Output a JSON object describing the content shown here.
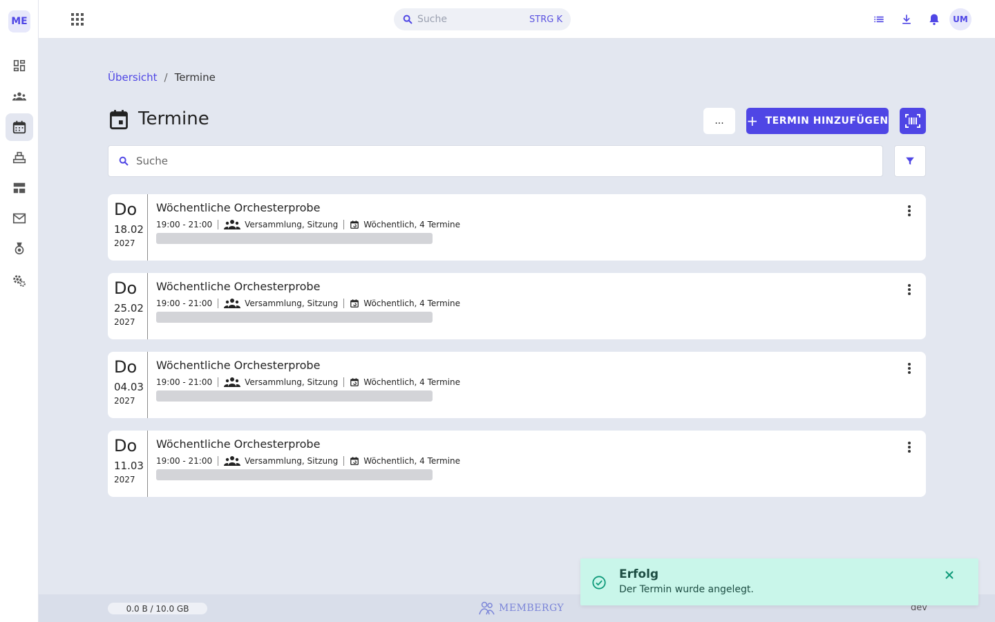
{
  "app": {
    "logo_text": "ME",
    "brand": "MEMBERGY",
    "env": "dev",
    "storage": "0.0 B / 10.0 GB"
  },
  "sidebar": {
    "items": [
      {
        "name": "dashboard",
        "icon": "dashboard-icon"
      },
      {
        "name": "members",
        "icon": "people-icon"
      },
      {
        "name": "events",
        "icon": "calendar-icon",
        "active": true
      },
      {
        "name": "inventory",
        "icon": "inventory-icon"
      },
      {
        "name": "layout",
        "icon": "table-icon"
      },
      {
        "name": "mail",
        "icon": "mail-icon"
      },
      {
        "name": "awards",
        "icon": "medal-icon"
      },
      {
        "name": "settings",
        "icon": "settings-icon"
      }
    ]
  },
  "topbar": {
    "search_placeholder": "Suche",
    "search_shortcut": "STRG K",
    "avatar_initials": "UM",
    "icons": [
      "list-icon",
      "download-icon",
      "bell-icon"
    ]
  },
  "breadcrumb": {
    "home": "Übersicht",
    "separator": "/",
    "current": "Termine"
  },
  "page": {
    "title": "Termine",
    "more_label": "...",
    "add_label": "TERMIN HINZUFÜGEN",
    "search_placeholder": "Suche"
  },
  "events": [
    {
      "dow": "Do",
      "date": "18.02",
      "year": "2027",
      "title": "Wöchentliche Orchesterprobe",
      "time": "19:00 - 21:00",
      "type": "Versammlung, Sitzung",
      "recurrence": "Wöchentlich, 4 Termine"
    },
    {
      "dow": "Do",
      "date": "25.02",
      "year": "2027",
      "title": "Wöchentliche Orchesterprobe",
      "time": "19:00 - 21:00",
      "type": "Versammlung, Sitzung",
      "recurrence": "Wöchentlich, 4 Termine"
    },
    {
      "dow": "Do",
      "date": "04.03",
      "year": "2027",
      "title": "Wöchentliche Orchesterprobe",
      "time": "19:00 - 21:00",
      "type": "Versammlung, Sitzung",
      "recurrence": "Wöchentlich, 4 Termine"
    },
    {
      "dow": "Do",
      "date": "11.03",
      "year": "2027",
      "title": "Wöchentliche Orchesterprobe",
      "time": "19:00 - 21:00",
      "type": "Versammlung, Sitzung",
      "recurrence": "Wöchentlich, 4 Termine"
    }
  ],
  "toast": {
    "title": "Erfolg",
    "message": "Der Termin wurde angelegt."
  },
  "colors": {
    "accent": "#4f46e5",
    "toast_bg": "#c9f6ea",
    "toast_icon": "#0f9a7a",
    "background": "#e3e7f0"
  }
}
